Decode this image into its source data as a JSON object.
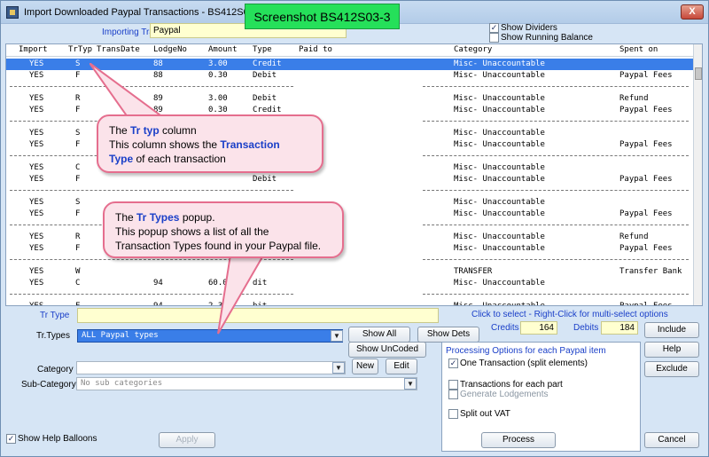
{
  "window": {
    "title": "Import Downloaded Paypal Transactions - BS412S03",
    "badge": "Screenshot BS412S03-3",
    "close_label": "X"
  },
  "importing": {
    "label": "Importing Transactions to",
    "value": "Paypal"
  },
  "toggles": {
    "show_dividers": "Show Dividers",
    "show_running_balance": "Show Running Balance"
  },
  "grid": {
    "columns": [
      "Import",
      "TrTyp",
      "TransDate",
      "LodgeNo",
      "Amount",
      "Type",
      "Paid to",
      "Category",
      "Spent on"
    ],
    "divider": "----------------------------------",
    "rows": [
      {
        "import": "YES",
        "trtyp": "S",
        "date": "",
        "lodge": "88",
        "amount": "3.00",
        "type": "Credit",
        "category": "Misc- Unaccountable",
        "spent": ""
      },
      {
        "import": "YES",
        "trtyp": "F",
        "date": "",
        "lodge": "88",
        "amount": "0.30",
        "type": "Debit",
        "category": "Misc- Unaccountable",
        "spent": "Paypal Fees"
      },
      {
        "import": "YES",
        "trtyp": "R",
        "date": "",
        "lodge": "89",
        "amount": "3.00",
        "type": "Debit",
        "category": "Misc- Unaccountable",
        "spent": "Refund"
      },
      {
        "import": "YES",
        "trtyp": "F",
        "date": "",
        "lodge": "89",
        "amount": "0.30",
        "type": "Credit",
        "category": "Misc- Unaccountable",
        "spent": "Paypal Fees"
      },
      {
        "import": "YES",
        "trtyp": "S",
        "date": "",
        "lodge": "",
        "amount": "",
        "type": "",
        "category": "Misc- Unaccountable",
        "spent": ""
      },
      {
        "import": "YES",
        "trtyp": "F",
        "date": "",
        "lodge": "",
        "amount": "",
        "type": "",
        "category": "Misc- Unaccountable",
        "spent": "Paypal Fees"
      },
      {
        "import": "YES",
        "trtyp": "C",
        "date": "",
        "lodge": "",
        "amount": "",
        "type": "",
        "category": "Misc- Unaccountable",
        "spent": ""
      },
      {
        "import": "YES",
        "trtyp": "F",
        "date": "",
        "lodge": "",
        "amount": "",
        "type": "Debit",
        "category": "Misc- Unaccountable",
        "spent": "Paypal Fees"
      },
      {
        "import": "YES",
        "trtyp": "S",
        "date": "",
        "lodge": "",
        "amount": "",
        "type": "",
        "category": "Misc- Unaccountable",
        "spent": ""
      },
      {
        "import": "YES",
        "trtyp": "F",
        "date": "",
        "lodge": "",
        "amount": "",
        "type": "",
        "category": "Misc- Unaccountable",
        "spent": "Paypal Fees"
      },
      {
        "import": "YES",
        "trtyp": "R",
        "date": "",
        "lodge": "",
        "amount": "",
        "type": "",
        "category": "Misc- Unaccountable",
        "spent": "Refund"
      },
      {
        "import": "YES",
        "trtyp": "F",
        "date": "",
        "lodge": "",
        "amount": "",
        "type": "",
        "category": "Misc- Unaccountable",
        "spent": "Paypal Fees"
      },
      {
        "import": "YES",
        "trtyp": "W",
        "date": "",
        "lodge": "",
        "amount": "",
        "type": "",
        "category": "TRANSFER",
        "spent": "Transfer Bank"
      },
      {
        "import": "YES",
        "trtyp": "C",
        "date": "",
        "lodge": "94",
        "amount": "60.00",
        "type": "dit",
        "category": "Misc- Unaccountable",
        "spent": ""
      },
      {
        "import": "YES",
        "trtyp": "F",
        "date": "",
        "lodge": "94",
        "amount": "2.34",
        "type": "bit",
        "category": "Misc- Unaccountable",
        "spent": "Paypal Fees"
      }
    ]
  },
  "callouts": {
    "trtyp": {
      "line1_pre": "The ",
      "line1_bold": "Tr typ",
      "line1_post": " column",
      "line2_pre": "This column shows the ",
      "line2_bold": "Transaction",
      "line3_bold": "Type",
      "line3_post": " of each transaction"
    },
    "trtypes": {
      "line1_pre": "The ",
      "line1_bold": "Tr Types",
      "line1_post": " popup.",
      "line2": "This popup shows a list of all the",
      "line3": "Transaction Types found in your Paypal file."
    }
  },
  "form": {
    "trtype_label": "Tr Type",
    "trtypes_label": "Tr.Types",
    "trtypes_value": "ALL Paypal types",
    "click_hint": "Click to select  - Right-Click for multi-select options",
    "credits_label": "Credits",
    "credits_value": "164",
    "debits_label": "Debits",
    "debits_value": "184",
    "category_label": "Category",
    "subcategory_label": "Sub-Category",
    "subcategory_value": "No sub categories",
    "show_help_balloons": "Show Help Balloons"
  },
  "buttons": {
    "show_all": "Show All",
    "show_dets": "Show Dets",
    "show_uncoded": "Show UnCoded",
    "new": "New",
    "edit": "Edit",
    "include": "Include",
    "help": "Help",
    "exclude": "Exclude",
    "apply": "Apply",
    "process": "Process",
    "cancel": "Cancel"
  },
  "options": {
    "title": "Processing Options for each Paypal  item",
    "one_transaction": "One Transaction (split elements)",
    "each_part": "Transactions for each part",
    "generate_lodgements": "Generate Lodgements",
    "split_vat": "Split out VAT"
  },
  "colors": {
    "accent": "#1a3fc8",
    "selection": "#3a7ee8",
    "badge": "#25e05a",
    "callout": "#fbe3ea"
  }
}
